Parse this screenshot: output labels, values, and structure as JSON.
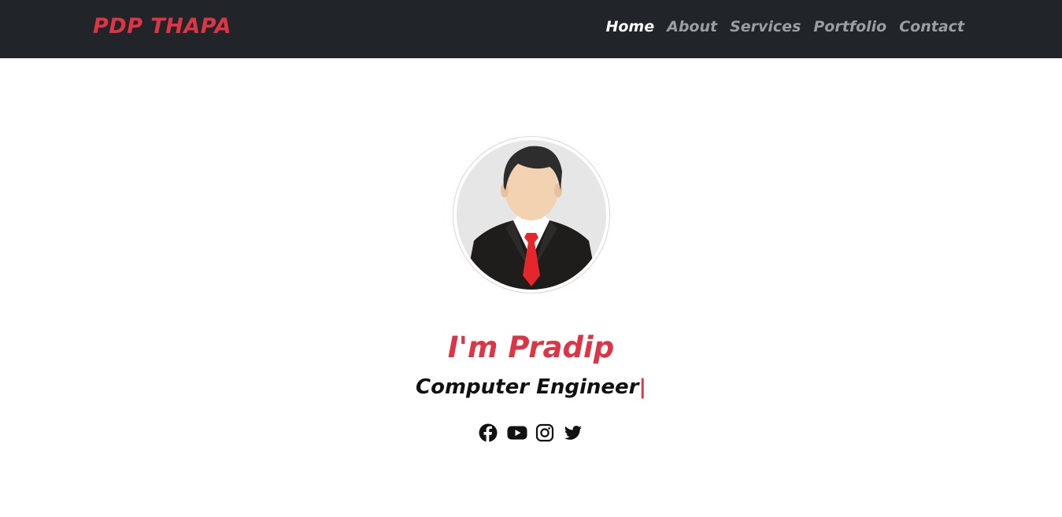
{
  "brand": "PDP THAPA",
  "nav": {
    "items": [
      {
        "label": "Home",
        "active": true
      },
      {
        "label": "About",
        "active": false
      },
      {
        "label": "Services",
        "active": false
      },
      {
        "label": "Portfolio",
        "active": false
      },
      {
        "label": "Contact",
        "active": false
      }
    ]
  },
  "hero": {
    "greeting": "I'm Pradip",
    "role": "Computer Engineer",
    "cursor": "|",
    "avatar": "businessman-avatar"
  },
  "socials": [
    {
      "name": "facebook-icon"
    },
    {
      "name": "youtube-icon"
    },
    {
      "name": "instagram-icon"
    },
    {
      "name": "twitter-icon"
    }
  ],
  "colors": {
    "navbar": "#212529",
    "accent": "#dc3545",
    "nav_inactive": "#9a9da1",
    "text_dark": "#111111"
  }
}
